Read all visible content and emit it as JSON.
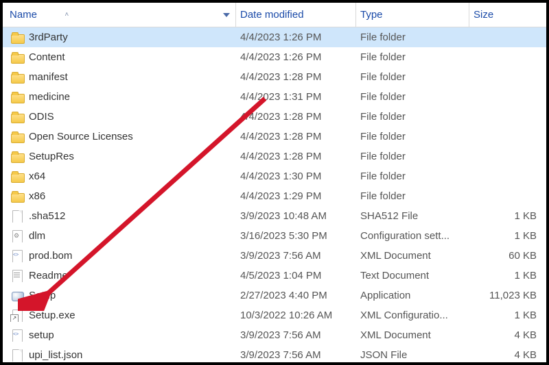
{
  "columns": {
    "name": "Name",
    "date": "Date modified",
    "type": "Type",
    "size": "Size"
  },
  "sorted_by": "name",
  "sort_dir": "asc",
  "selected_index": 0,
  "rows": [
    {
      "icon": "folder",
      "name": "3rdParty",
      "date": "4/4/2023 1:26 PM",
      "type": "File folder",
      "size": ""
    },
    {
      "icon": "folder",
      "name": "Content",
      "date": "4/4/2023 1:26 PM",
      "type": "File folder",
      "size": ""
    },
    {
      "icon": "folder",
      "name": "manifest",
      "date": "4/4/2023 1:28 PM",
      "type": "File folder",
      "size": ""
    },
    {
      "icon": "folder",
      "name": "medicine",
      "date": "4/4/2023 1:31 PM",
      "type": "File folder",
      "size": ""
    },
    {
      "icon": "folder",
      "name": "ODIS",
      "date": "4/4/2023 1:28 PM",
      "type": "File folder",
      "size": ""
    },
    {
      "icon": "folder",
      "name": "Open Source Licenses",
      "date": "4/4/2023 1:28 PM",
      "type": "File folder",
      "size": ""
    },
    {
      "icon": "folder",
      "name": "SetupRes",
      "date": "4/4/2023 1:28 PM",
      "type": "File folder",
      "size": ""
    },
    {
      "icon": "folder",
      "name": "x64",
      "date": "4/4/2023 1:30 PM",
      "type": "File folder",
      "size": ""
    },
    {
      "icon": "folder",
      "name": "x86",
      "date": "4/4/2023 1:29 PM",
      "type": "File folder",
      "size": ""
    },
    {
      "icon": "file",
      "name": ".sha512",
      "date": "3/9/2023 10:48 AM",
      "type": "SHA512 File",
      "size": "1 KB"
    },
    {
      "icon": "ini",
      "name": "dlm",
      "date": "3/16/2023 5:30 PM",
      "type": "Configuration sett...",
      "size": "1 KB"
    },
    {
      "icon": "xml",
      "name": "prod.bom",
      "date": "3/9/2023 7:56 AM",
      "type": "XML Document",
      "size": "60 KB"
    },
    {
      "icon": "txt",
      "name": "Readme",
      "date": "4/5/2023 1:04 PM",
      "type": "Text Document",
      "size": "1 KB"
    },
    {
      "icon": "exe",
      "name": "Setup",
      "date": "2/27/2023 4:40 PM",
      "type": "Application",
      "size": "11,023 KB"
    },
    {
      "icon": "execonf",
      "name": "Setup.exe",
      "date": "10/3/2022 10:26 AM",
      "type": "XML Configuratio...",
      "size": "1 KB"
    },
    {
      "icon": "xml",
      "name": "setup",
      "date": "3/9/2023 7:56 AM",
      "type": "XML Document",
      "size": "4 KB"
    },
    {
      "icon": "file",
      "name": "upi_list.json",
      "date": "3/9/2023 7:56 AM",
      "type": "JSON File",
      "size": "4 KB"
    }
  ],
  "annotation": {
    "points_to": "Setup",
    "color": "#d4152a"
  }
}
